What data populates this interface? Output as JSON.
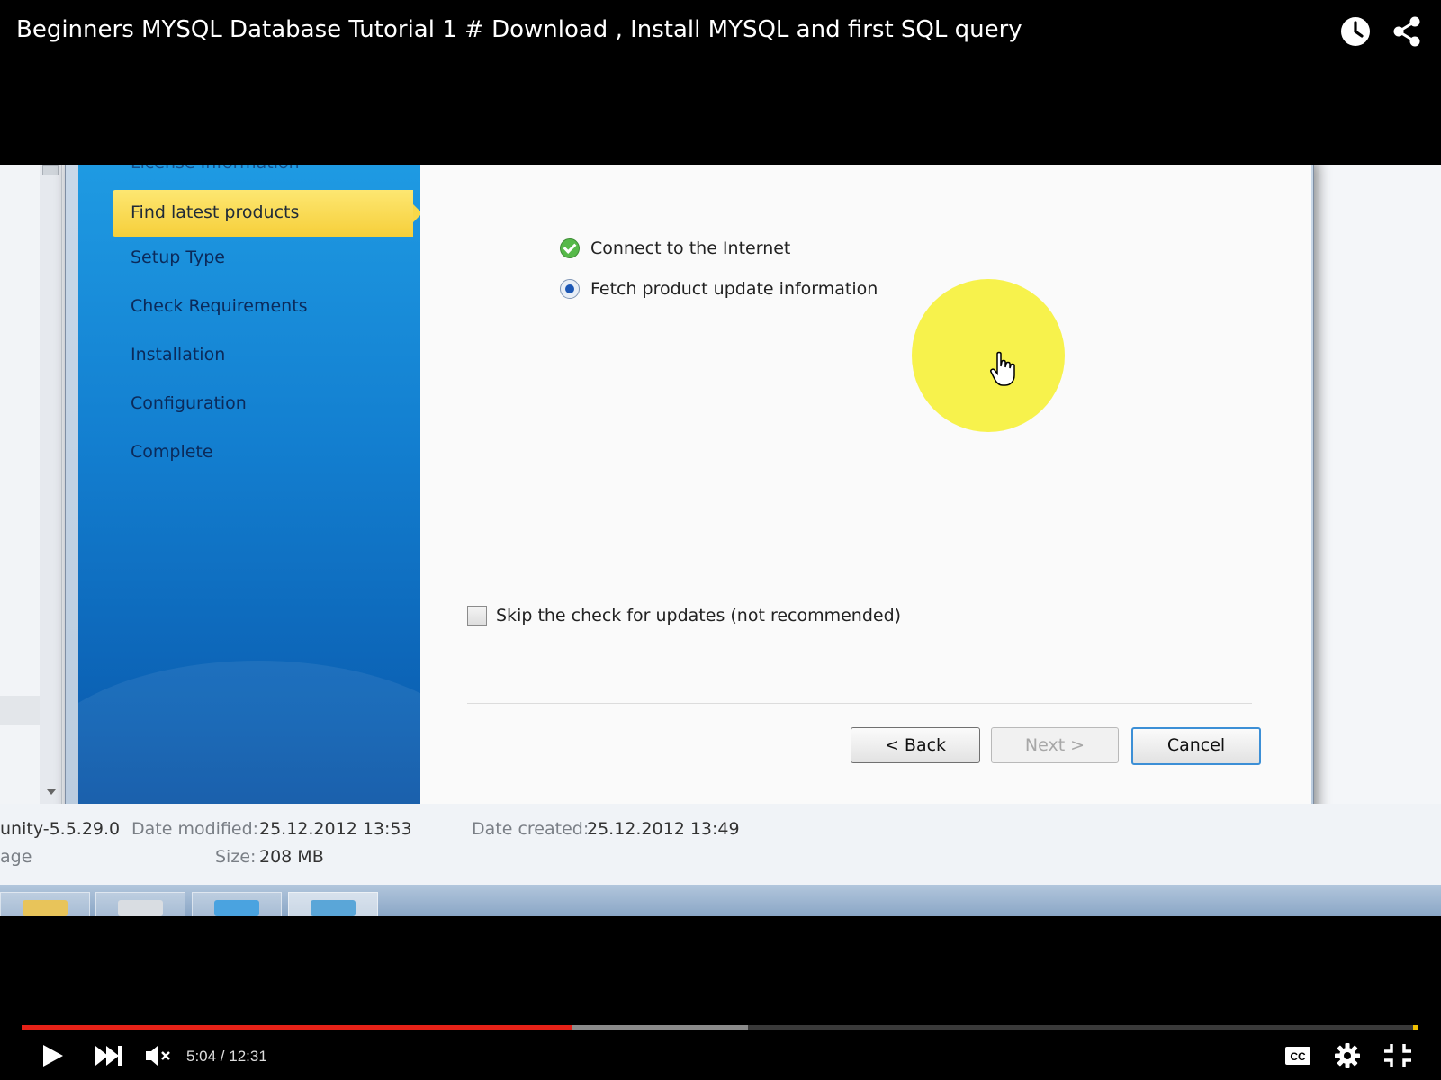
{
  "video": {
    "title": "Beginners MYSQL Database Tutorial 1 # Download , Install MYSQL and first SQL query"
  },
  "installer": {
    "steps": [
      {
        "label": "License Information",
        "state": "done"
      },
      {
        "label": "Find latest products",
        "state": "active"
      },
      {
        "label": "Setup Type",
        "state": "pending"
      },
      {
        "label": "Check Requirements",
        "state": "pending"
      },
      {
        "label": "Installation",
        "state": "pending"
      },
      {
        "label": "Configuration",
        "state": "pending"
      },
      {
        "label": "Complete",
        "state": "pending"
      }
    ],
    "tasks": [
      {
        "label": "Connect to the Internet",
        "status": "done"
      },
      {
        "label": "Fetch product update information",
        "status": "in-progress"
      }
    ],
    "skip_label": "Skip the check for updates (not recommended)",
    "skip_checked": false,
    "buttons": {
      "back": "< Back",
      "next": "Next >",
      "cancel": "Cancel"
    }
  },
  "explorer": {
    "file_name_partial": "unity-5.5.29.0",
    "type_partial": "age",
    "date_modified_label": "Date modified:",
    "date_modified": "25.12.2012 13:53",
    "date_created_label": "Date created:",
    "date_created": "25.12.2012 13:49",
    "size_label": "Size:",
    "size": "208 MB"
  },
  "player": {
    "time": "5:04 / 12:31",
    "progress_fraction": 0.394,
    "buffered_fraction": 0.52,
    "cc_label": "CC",
    "colors": {
      "played": "#e62117",
      "buffer": "#8b8b8b",
      "track": "#3a3a3a"
    }
  },
  "icons": {
    "watch_later": "clock-icon",
    "share": "share-icon",
    "play": "play-icon",
    "next": "skip-next-icon",
    "mute": "volume-muted-icon",
    "settings": "gear-icon",
    "fullscreen_exit": "exit-fullscreen-icon",
    "cursor": "hand-pointer-icon"
  }
}
